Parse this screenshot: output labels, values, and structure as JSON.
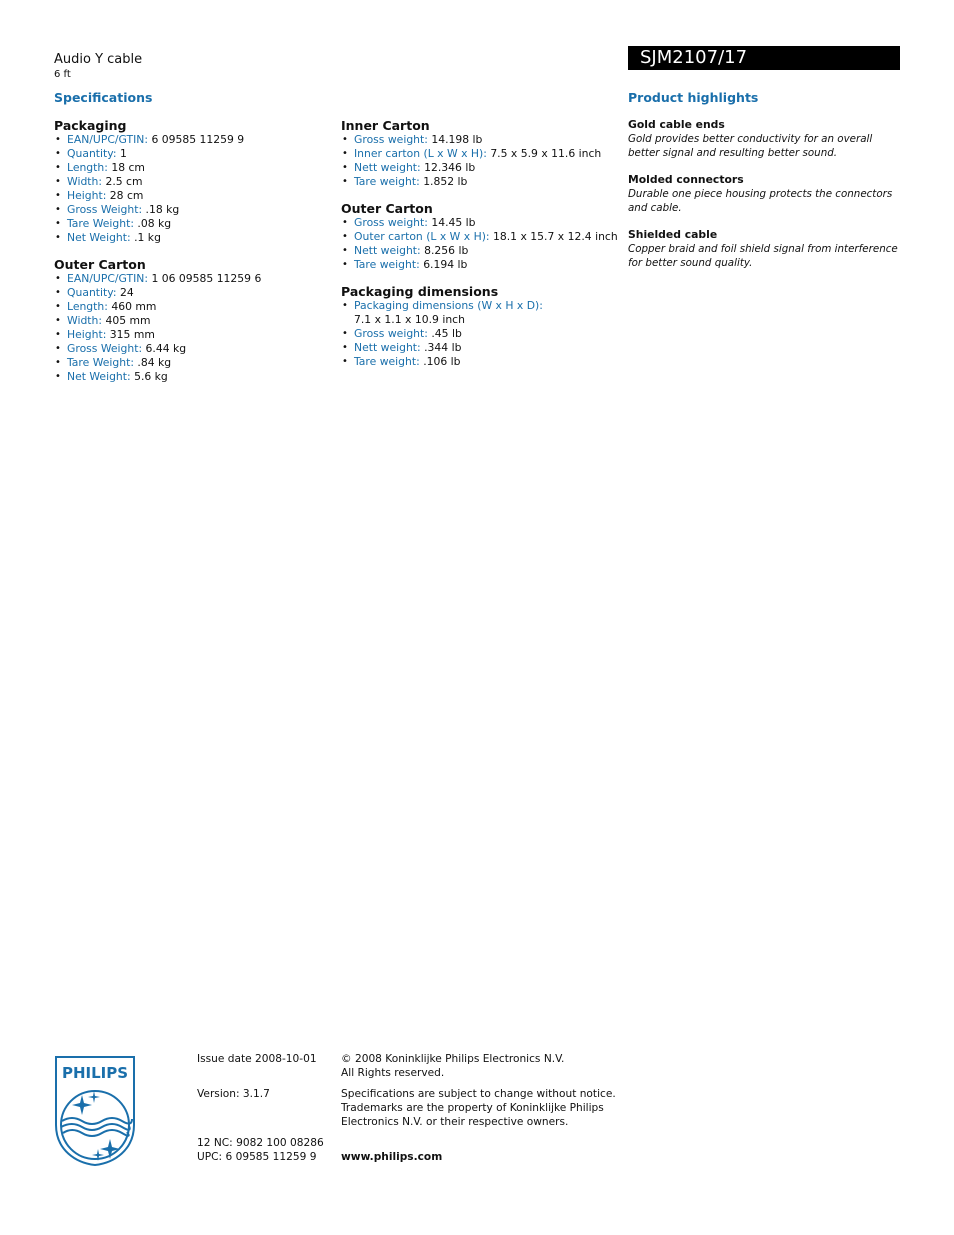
{
  "header": {
    "product_name": "Audio Y cable",
    "product_subtitle": "6 ft",
    "model_number": "SJM2107/17"
  },
  "specifications": {
    "title": "Specifications",
    "column1": [
      {
        "title": "Packaging",
        "items": [
          {
            "label": "EAN/UPC/GTIN:",
            "value": "6 09585 11259 9"
          },
          {
            "label": "Quantity:",
            "value": "1"
          },
          {
            "label": "Length:",
            "value": "18 cm"
          },
          {
            "label": "Width:",
            "value": "2.5 cm"
          },
          {
            "label": "Height:",
            "value": "28 cm"
          },
          {
            "label": "Gross Weight:",
            "value": ".18 kg"
          },
          {
            "label": "Tare Weight:",
            "value": ".08 kg"
          },
          {
            "label": "Net Weight:",
            "value": ".1 kg"
          }
        ]
      },
      {
        "title": "Outer Carton",
        "items": [
          {
            "label": "EAN/UPC/GTIN:",
            "value": "1 06 09585 11259 6"
          },
          {
            "label": "Quantity:",
            "value": "24"
          },
          {
            "label": "Length:",
            "value": "460 mm"
          },
          {
            "label": "Width:",
            "value": "405 mm"
          },
          {
            "label": "Height:",
            "value": "315 mm"
          },
          {
            "label": "Gross Weight:",
            "value": "6.44 kg"
          },
          {
            "label": "Tare Weight:",
            "value": ".84 kg"
          },
          {
            "label": "Net Weight:",
            "value": "5.6 kg"
          }
        ]
      }
    ],
    "column2": [
      {
        "title": "Inner Carton",
        "items": [
          {
            "label": "Gross weight:",
            "value": "14.198 lb"
          },
          {
            "label": "Inner carton (L x W x H):",
            "value": "7.5 x 5.9 x 11.6 inch"
          },
          {
            "label": "Nett weight:",
            "value": "12.346 lb"
          },
          {
            "label": "Tare weight:",
            "value": "1.852 lb"
          }
        ]
      },
      {
        "title": "Outer Carton",
        "items": [
          {
            "label": "Gross weight:",
            "value": "14.45 lb"
          },
          {
            "label": "Outer carton (L x W x H):",
            "value": "18.1 x 15.7 x 12.4 inch"
          },
          {
            "label": "Nett weight:",
            "value": "8.256 lb"
          },
          {
            "label": "Tare weight:",
            "value": "6.194 lb"
          }
        ]
      },
      {
        "title": "Packaging dimensions",
        "items": [
          {
            "label": "Packaging dimensions (W x H x D):",
            "value": "7.1 x 1.1 x 10.9 inch",
            "wrap": true
          },
          {
            "label": "Gross weight:",
            "value": ".45 lb"
          },
          {
            "label": "Nett weight:",
            "value": ".344 lb"
          },
          {
            "label": "Tare weight:",
            "value": ".106 lb"
          }
        ]
      }
    ]
  },
  "highlights": {
    "title": "Product highlights",
    "items": [
      {
        "title": "Gold cable ends",
        "description": "Gold provides better conductivity for an overall better signal and resulting better sound."
      },
      {
        "title": "Molded connectors",
        "description": "Durable one piece housing protects the connectors and cable."
      },
      {
        "title": "Shielded cable",
        "description": "Copper braid and foil shield signal from interference for better sound quality."
      }
    ]
  },
  "footer": {
    "logo_text": "PHILIPS",
    "issue_date": "Issue date 2008-10-01",
    "version": "Version: 3.1.7",
    "nc": "12 NC: 9082 100 08286",
    "upc": "UPC: 6 09585 11259 9",
    "copyright_line1": "© 2008 Koninklijke Philips Electronics N.V.",
    "copyright_line2": "All Rights reserved.",
    "notice_line1": "Specifications are subject to change without notice.",
    "notice_line2": "Trademarks are the property of Koninklijke Philips",
    "notice_line3": "Electronics N.V. or their respective owners.",
    "website": "www.philips.com"
  },
  "colors": {
    "accent": "#1a6fab",
    "text": "#111111",
    "model_bar_bg": "#000000",
    "model_bar_text": "#ffffff"
  }
}
